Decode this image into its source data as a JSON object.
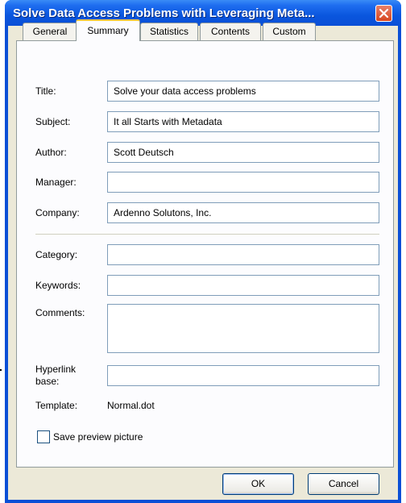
{
  "window": {
    "title": "Solve Data Access Problems with Leveraging Meta..."
  },
  "tabs": [
    {
      "label": "General",
      "active": false
    },
    {
      "label": "Summary",
      "active": true
    },
    {
      "label": "Statistics",
      "active": false
    },
    {
      "label": "Contents",
      "active": false
    },
    {
      "label": "Custom",
      "active": false
    }
  ],
  "summary": {
    "title_label": "Title:",
    "title_value": "Solve your data access problems",
    "subject_label": "Subject:",
    "subject_value": "It all Starts with Metadata",
    "author_label": "Author:",
    "author_value": "Scott Deutsch",
    "manager_label": "Manager:",
    "manager_value": "",
    "company_label": "Company:",
    "company_value": "Ardenno Solutons, Inc.",
    "category_label": "Category:",
    "category_value": "",
    "keywords_label": "Keywords:",
    "keywords_value": "",
    "comments_label": "Comments:",
    "comments_value": "",
    "hyperlink_label_line1": "Hyperlink",
    "hyperlink_label_line2": "base:",
    "hyperlink_value": "",
    "template_label": "Template:",
    "template_value": "Normal.dot",
    "save_preview_label": "Save preview picture",
    "save_preview_checked": false
  },
  "buttons": {
    "ok": "OK",
    "cancel": "Cancel"
  },
  "colors": {
    "titlebar": "#0a4fd6",
    "dialog_bg": "#ece9d8",
    "tab_active_accent": "#ffc83c",
    "field_border": "#7f9db9",
    "close_button": "#d8461e"
  },
  "icons": {
    "close": "close-icon"
  }
}
